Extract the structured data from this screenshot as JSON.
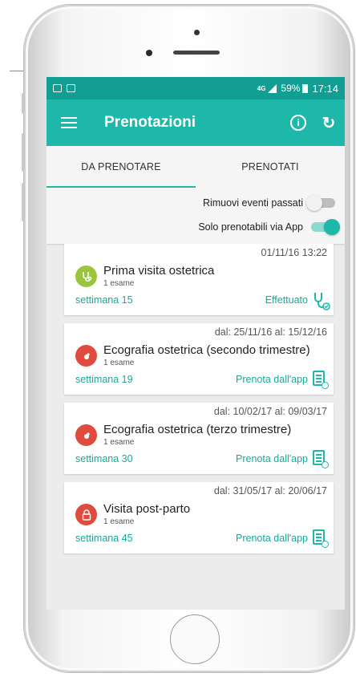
{
  "status_bar": {
    "network": "4G",
    "battery": "59%",
    "time": "17:14"
  },
  "app_bar": {
    "title": "Prenotazioni",
    "info_glyph": "i",
    "history_glyph": "↻"
  },
  "tabs": [
    {
      "label": "DA PRENOTARE",
      "active": true
    },
    {
      "label": "PRENOTATI",
      "active": false
    }
  ],
  "filters": [
    {
      "label": "Rimuovi eventi passati",
      "on": false
    },
    {
      "label": "Solo prenotabili via App",
      "on": true
    }
  ],
  "cards": [
    {
      "date": "01/11/16 13:22",
      "title": "Prima visita ostetrica",
      "sub": "1 esame",
      "week": "settimana 15",
      "action": "Effettuato",
      "icon": "stethoscope-icon",
      "avatar_color": "#9bc53d"
    },
    {
      "date": "dal: 25/11/16 al: 15/12/16",
      "title": "Ecografia ostetrica (secondo trimestre)",
      "sub": "1 esame",
      "week": "settimana 19",
      "action": "Prenota dall'app",
      "icon": "document-icon",
      "avatar_color": "#e04b3f"
    },
    {
      "date": "dal: 10/02/17 al: 09/03/17",
      "title": "Ecografia ostetrica (terzo trimestre)",
      "sub": "1 esame",
      "week": "settimana 30",
      "action": "Prenota dall'app",
      "icon": "document-icon",
      "avatar_color": "#e04b3f"
    },
    {
      "date": "dal: 31/05/17 al: 20/06/17",
      "title": "Visita post-parto",
      "sub": "1 esame",
      "week": "settimana 45",
      "action": "Prenota dall'app",
      "icon": "document-icon",
      "avatar_color": "#e04b3f"
    }
  ],
  "colors": {
    "primary": "#1eb8aa",
    "status_bar": "#139e93",
    "accent_text": "#1aa79a"
  }
}
